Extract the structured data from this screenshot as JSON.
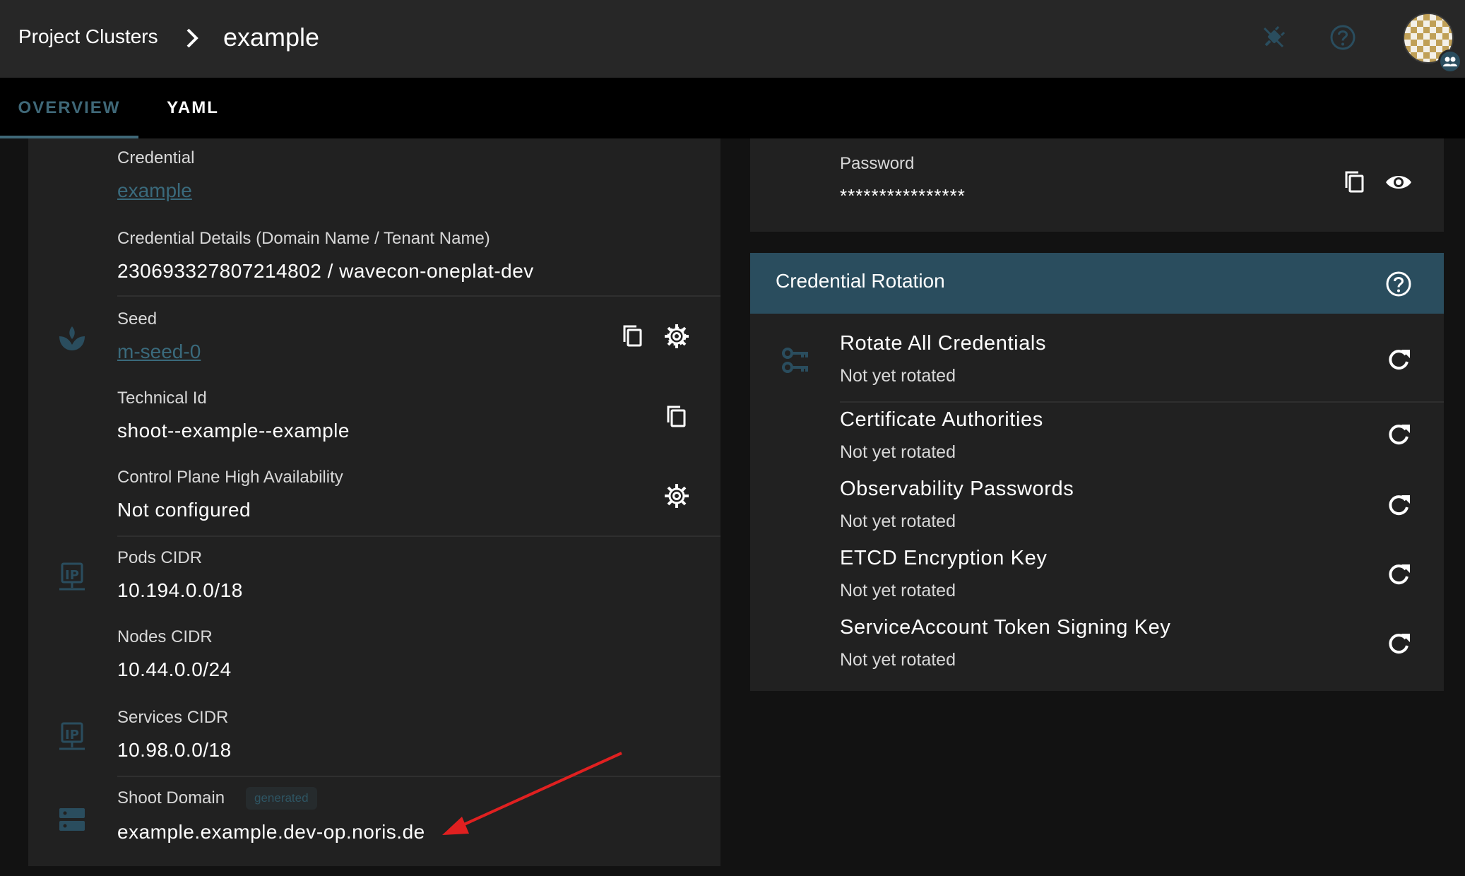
{
  "header": {
    "breadcrumb_parent": "Project Clusters",
    "breadcrumb_current": "example",
    "icons": [
      "breadcrumb-chevron-icon",
      "plug-disconnected-icon",
      "help-circle-icon",
      "avatar",
      "account-group-icon"
    ]
  },
  "tabs": [
    {
      "label": "Overview",
      "active": true
    },
    {
      "label": "YAML",
      "active": false
    }
  ],
  "infra": {
    "credential": {
      "label": "Credential",
      "value": "example"
    },
    "credential_details": {
      "label": "Credential Details (Domain Name / Tenant Name)",
      "value": "230693327807214802 / wavecon-oneplat-dev"
    },
    "seed": {
      "label": "Seed",
      "value": "m-seed-0"
    },
    "technical_id": {
      "label": "Technical Id",
      "value": "shoot--example--example"
    },
    "ha": {
      "label": "Control Plane High Availability",
      "value": "Not configured"
    },
    "pods_cidr": {
      "label": "Pods CIDR",
      "value": "10.194.0.0/18"
    },
    "nodes_cidr": {
      "label": "Nodes CIDR",
      "value": "10.44.0.0/24"
    },
    "services_cidr": {
      "label": "Services CIDR",
      "value": "10.98.0.0/18"
    },
    "shoot_domain": {
      "label": "Shoot Domain",
      "chip": "generated",
      "value": "example.example.dev-op.noris.de"
    }
  },
  "password": {
    "label": "Password",
    "value": "****************"
  },
  "rotation": {
    "title": "Credential Rotation",
    "items": [
      {
        "name": "Rotate All Credentials",
        "status": "Not yet rotated"
      },
      {
        "name": "Certificate Authorities",
        "status": "Not yet rotated"
      },
      {
        "name": "Observability Passwords",
        "status": "Not yet rotated"
      },
      {
        "name": "ETCD Encryption Key",
        "status": "Not yet rotated"
      },
      {
        "name": "ServiceAccount Token Signing Key",
        "status": "Not yet rotated"
      }
    ]
  },
  "colors": {
    "accent": "#3a6a7c",
    "header_bar": "#2a4d5e",
    "annotation_arrow": "#e02020",
    "card_bg": "#212121",
    "page_bg": "#121212"
  }
}
